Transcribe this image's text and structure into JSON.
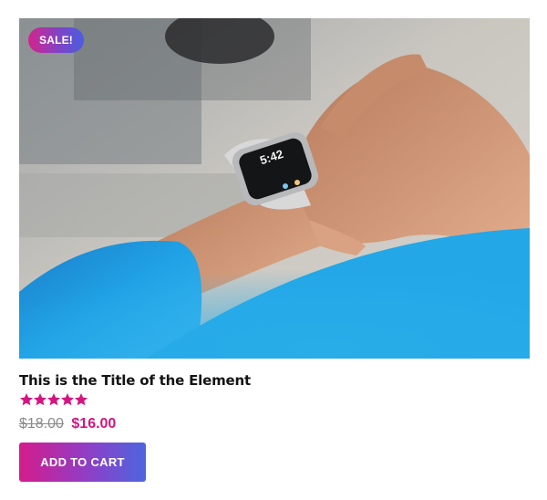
{
  "product": {
    "badge": "SALE!",
    "image_alt": "smartwatch-photo",
    "title": "This is the Title of the Element",
    "rating": 5,
    "rating_max": 5,
    "old_price": "$18.00",
    "new_price": "$16.00",
    "watch_time": "5:42",
    "cart_label": "ADD TO CART"
  },
  "colors": {
    "accent": "#d4157f",
    "gradient_start": "#d41c8c",
    "gradient_end": "#4c66df",
    "star": "#d4157f"
  }
}
